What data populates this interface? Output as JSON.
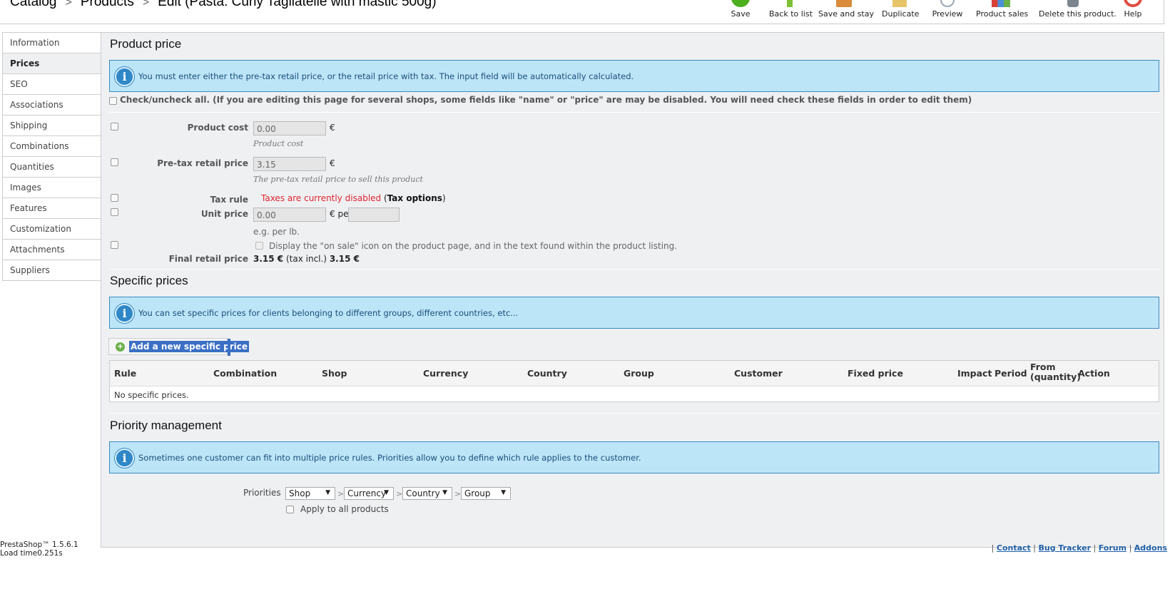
{
  "breadcrumb": {
    "items": [
      "Catalog",
      "Products",
      "Edit (Pasta: Curly Tagliatelle with mastic 500g)"
    ],
    "separator": ">"
  },
  "toolbar": {
    "buttons": [
      {
        "label": "Save",
        "icon": "save-icon",
        "color": "#4caf1e"
      },
      {
        "label": "Back to list",
        "icon": "back-to-list-icon",
        "color": "#7cc034"
      },
      {
        "label": "Save and stay",
        "icon": "save-and-stay-icon",
        "color": "#d98b3a"
      },
      {
        "label": "Duplicate",
        "icon": "duplicate-icon",
        "color": "#e7c46a"
      },
      {
        "label": "Preview",
        "icon": "preview-icon",
        "color": "#9aa7b5"
      },
      {
        "label": "Product sales",
        "icon": "product-sales-icon",
        "color": "#d7413a"
      },
      {
        "label": "Delete this product.",
        "icon": "trash-icon",
        "color": "#7d8590"
      },
      {
        "label": "Help",
        "icon": "help-icon",
        "color": "#e04b3f"
      }
    ]
  },
  "tabs": [
    "Information",
    "Prices",
    "SEO",
    "Associations",
    "Shipping",
    "Combinations",
    "Quantities",
    "Images",
    "Features",
    "Customization",
    "Attachments",
    "Suppliers"
  ],
  "active_tab": "Prices",
  "product_price": {
    "title": "Product price",
    "info": "You must enter either the pre-tax retail price, or the retail price with tax. The input field will be automatically calculated.",
    "check_all": "Check/uncheck all. (If you are editing this page for several shops, some fields like \"name\" or \"price\" are may be disabled. You will need check these fields in order to edit them)",
    "product_cost_label": "Product cost",
    "product_cost_value": "0.00",
    "product_cost_hint": "Product cost",
    "pretax_label": "Pre-tax retail price",
    "pretax_value": "3.15",
    "pretax_hint": "The pre-tax retail price to sell this product",
    "tax_rule_label": "Tax rule",
    "tax_disabled": "Taxes are currently disabled",
    "tax_options_open": "(",
    "tax_options": "Tax options",
    "tax_options_close": ")",
    "unit_price_label": "Unit price",
    "unit_price_value": "0.00",
    "unit_per": "€ per",
    "unit_per_value": "",
    "unit_hint": "e.g. per lb.",
    "on_sale": "Display the \"on sale\" icon on the product page, and in the text found within the product listing.",
    "final_label": "Final retail price",
    "final_price": "3.15 €",
    "final_tax_incl_label": "(tax incl.)",
    "final_tax_incl": "3.15 €",
    "currency": "€"
  },
  "specific_prices": {
    "title": "Specific prices",
    "info": "You can set specific prices for clients belonging to different groups, different countries, etc...",
    "add_button": "Add a new specific price",
    "columns": [
      "Rule",
      "Combination",
      "Shop",
      "Currency",
      "Country",
      "Group",
      "Customer",
      "Fixed price",
      "Impact",
      "Period",
      "From (quantity)",
      "Action"
    ],
    "empty": "No specific prices."
  },
  "priority": {
    "title": "Priority management",
    "info": "Sometimes one customer can fit into multiple price rules. Priorities allow you to define which rule applies to the customer.",
    "label": "Priorities",
    "selects": [
      "Shop",
      "Currency",
      "Country",
      "Group"
    ],
    "separator": ">",
    "apply_all": "Apply to all products"
  },
  "footer": {
    "version": "PrestaShop™ 1.5.6.1",
    "load_time": "Load time0.251s",
    "links": [
      "Contact",
      "Bug Tracker",
      "Forum",
      "Addons"
    ],
    "link_sep": "|"
  }
}
